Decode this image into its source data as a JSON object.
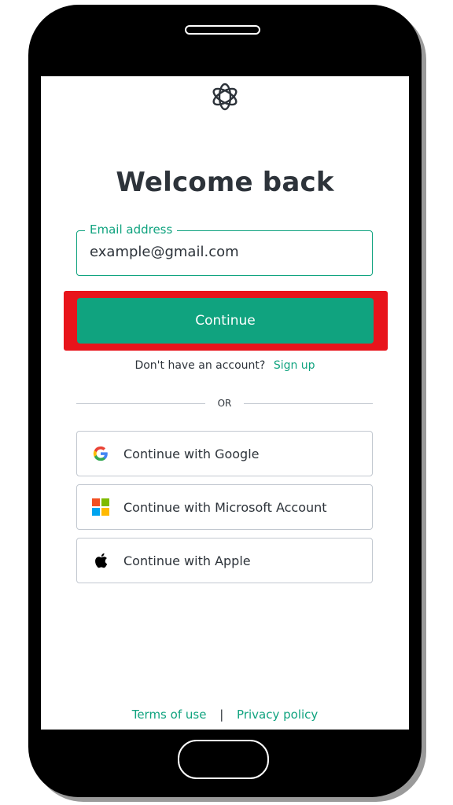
{
  "page": {
    "title": "Welcome back"
  },
  "email": {
    "label": "Email address",
    "value": "example@gmail.com"
  },
  "continue_button": {
    "label": "Continue"
  },
  "signup": {
    "prompt": "Don't have an account?",
    "link": "Sign up"
  },
  "divider": {
    "text": "OR"
  },
  "social": [
    {
      "label": "Continue with Google",
      "icon": "google-icon"
    },
    {
      "label": "Continue with Microsoft Account",
      "icon": "microsoft-icon"
    },
    {
      "label": "Continue with Apple",
      "icon": "apple-icon"
    }
  ],
  "footer": {
    "terms": "Terms of use",
    "separator": "|",
    "privacy": "Privacy policy"
  },
  "colors": {
    "accent": "#10a37f",
    "highlight": "#e8141b",
    "text": "#2d333a"
  }
}
